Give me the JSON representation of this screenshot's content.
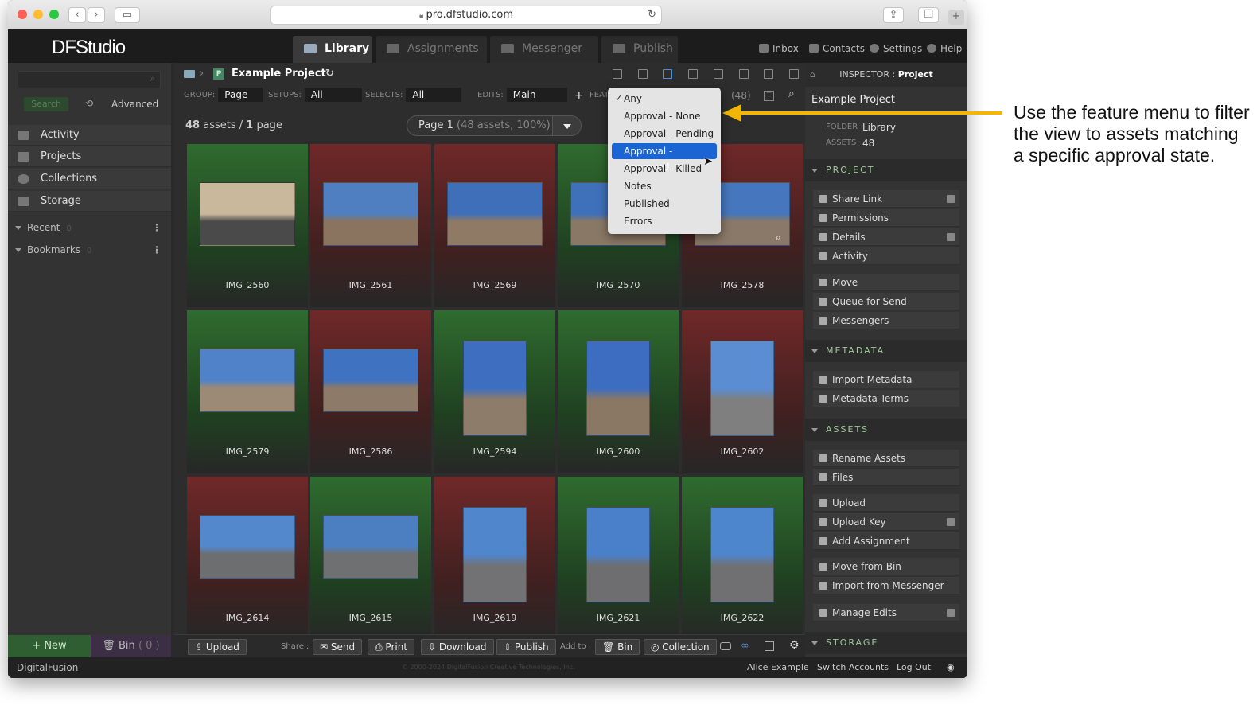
{
  "browser": {
    "url": "pro.dfstudio.com"
  },
  "app": {
    "logo": "DFStudio"
  },
  "tabs": [
    {
      "label": "Library"
    },
    {
      "label": "Assignments"
    },
    {
      "label": "Messenger"
    },
    {
      "label": "Publish"
    }
  ],
  "toplinks": {
    "inbox": "Inbox",
    "contacts": "Contacts",
    "settings": "Settings",
    "help": "Help"
  },
  "sidebar": {
    "search_button": "Search",
    "advanced": "Advanced",
    "items": [
      {
        "label": "Activity"
      },
      {
        "label": "Projects"
      },
      {
        "label": "Collections"
      },
      {
        "label": "Storage"
      }
    ],
    "groups": [
      {
        "label": "Recent",
        "count": "0"
      },
      {
        "label": "Bookmarks",
        "count": "0"
      }
    ],
    "new_button": "+ New",
    "bin_label": "Bin",
    "bin_count": "( 0 )"
  },
  "breadcrumb": {
    "title": "Example Project",
    "badge": "P"
  },
  "filters": {
    "group_label": "GROUP:",
    "group_value": "Page",
    "setups_label": "SETUPS:",
    "setups_value": "All",
    "selects_label": "SELECTS:",
    "selects_value": "All",
    "edits_label": "EDITS:",
    "edits_value": "Main",
    "plus": "+",
    "feature_label": "FEATUR",
    "count": "(48)"
  },
  "summary": {
    "assets": "48",
    "assets_label": "assets",
    "pages": "1",
    "pages_label": "page",
    "page_select": "Page 1",
    "page_detail": "(48 assets, 100%)"
  },
  "feature_menu": {
    "items": [
      "Any",
      "Approval - None",
      "Approval - Pending",
      "Approval - Approved",
      "Approval - Killed",
      "Notes",
      "Published",
      "Errors"
    ],
    "checked": "Any",
    "highlighted": "Approval - Approved",
    "check": "✓"
  },
  "assets": [
    {
      "name": "IMG_2560",
      "state": "green",
      "orient": "land",
      "sky": "#c9b89c",
      "ground": "#4a4a4a"
    },
    {
      "name": "IMG_2561",
      "state": "red",
      "orient": "land",
      "sky": "#4f7fc0",
      "ground": "#8a7460"
    },
    {
      "name": "IMG_2569",
      "state": "red",
      "orient": "land",
      "sky": "#3f6fb8",
      "ground": "#8f7a66"
    },
    {
      "name": "IMG_2570",
      "state": "green",
      "orient": "land",
      "sky": "#3f70ba",
      "ground": "#8a7866"
    },
    {
      "name": "IMG_2578",
      "state": "red",
      "orient": "land",
      "sky": "#4676bd",
      "ground": "#8a7868"
    },
    {
      "name": "IMG_2579",
      "state": "green",
      "orient": "land",
      "sky": "#4f82c8",
      "ground": "#9d8a76"
    },
    {
      "name": "IMG_2586",
      "state": "red",
      "orient": "land",
      "sky": "#3f72c0",
      "ground": "#8d7a68"
    },
    {
      "name": "IMG_2594",
      "state": "green",
      "orient": "port",
      "sky": "#3d6ec0",
      "ground": "#8e7c6a"
    },
    {
      "name": "IMG_2600",
      "state": "green",
      "orient": "port",
      "sky": "#3c6dc0",
      "ground": "#8a7864"
    },
    {
      "name": "IMG_2602",
      "state": "red",
      "orient": "port",
      "sky": "#5a8dd2",
      "ground": "#7f7f80"
    },
    {
      "name": "IMG_2614",
      "state": "red",
      "orient": "land",
      "sky": "#5388cc",
      "ground": "#6d6e70"
    },
    {
      "name": "IMG_2615",
      "state": "green",
      "orient": "land",
      "sky": "#4c7ec2",
      "ground": "#6f7072"
    },
    {
      "name": "IMG_2619",
      "state": "red",
      "orient": "port",
      "sky": "#4f86cc",
      "ground": "#727274"
    },
    {
      "name": "IMG_2621",
      "state": "green",
      "orient": "port",
      "sky": "#4a80ca",
      "ground": "#6e6e70"
    },
    {
      "name": "IMG_2622",
      "state": "green",
      "orient": "port",
      "sky": "#4e86ce",
      "ground": "#707072"
    }
  ],
  "bottombar": {
    "upload": "Upload",
    "share_label": "Share :",
    "send": "Send",
    "print": "Print",
    "download": "Download",
    "publish": "Publish",
    "addto_label": "Add to :",
    "bin": "Bin",
    "collection": "Collection"
  },
  "inspector": {
    "title_prefix": "INSPECTOR :",
    "title": "Project",
    "name": "Example Project",
    "folder_label": "FOLDER",
    "folder": "Library",
    "assets_label": "ASSETS",
    "assets": "48",
    "sections": {
      "project": "PROJECT",
      "metadata": "METADATA",
      "assets": "ASSETS",
      "storage": "STORAGE"
    },
    "project_buttons": [
      "Share Link",
      "Permissions",
      "Details",
      "Activity"
    ],
    "project_buttons2": [
      "Move",
      "Queue for Send",
      "Messengers"
    ],
    "metadata_buttons": [
      "Import Metadata",
      "Metadata Terms"
    ],
    "assets_buttons": [
      "Rename Assets",
      "Files"
    ],
    "assets_buttons2": [
      "Upload",
      "Upload Key",
      "Add Assignment"
    ],
    "assets_buttons3": [
      "Move from Bin",
      "Import from Messenger"
    ],
    "assets_buttons4": [
      "Manage Edits"
    ]
  },
  "status": {
    "brand": "DigitalFusion",
    "copyright": "© 2000-2024 DigitalFusion Creative Technologies, Inc.",
    "user": "Alice Example",
    "switch": "Switch Accounts",
    "logout": "Log Out"
  },
  "annotation": "Use the feature menu to filter the view to assets matching a specific approval state.",
  "colors": {
    "accent": "#1a64d4",
    "arrow": "#f2b705",
    "approved": "#2f6b2f",
    "killed": "#702828"
  }
}
